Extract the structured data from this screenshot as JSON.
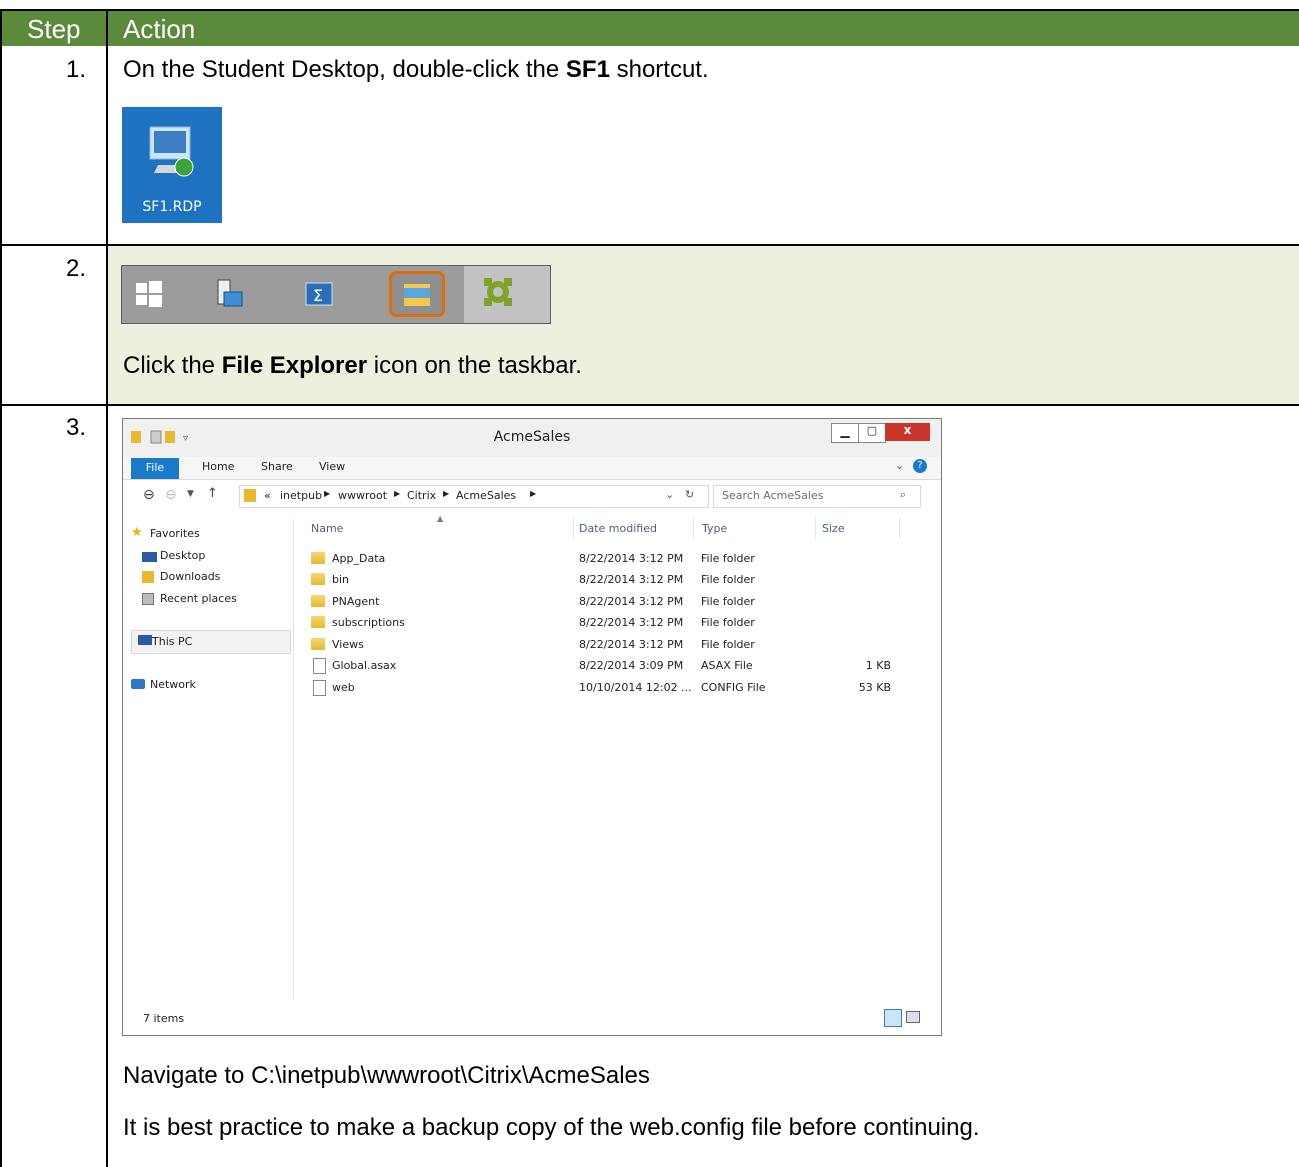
{
  "table": {
    "header_step": "Step",
    "header_action": "Action",
    "header_color": "#5a8a3a",
    "row_shade": "#ebf1de"
  },
  "steps": [
    {
      "number": "1.",
      "text_before": "On the Student Desktop, double-click the ",
      "bold": "SF1",
      "text_after": " shortcut.",
      "shortcut_label": "SF1.RDP"
    },
    {
      "number": "2.",
      "text_before": "Click the ",
      "bold": "File Explorer",
      "text_after": " icon on the taskbar.",
      "taskbar_icons": [
        "windows-start-icon",
        "server-manager-icon",
        "powershell-icon",
        "file-explorer-icon",
        "citrix-studio-icon"
      ],
      "highlight_color": "#e36c0a"
    },
    {
      "number": "3.",
      "line1": "Navigate to C:\\inetpub\\wwwroot\\Citrix\\AcmeSales",
      "line2": "It is best practice to make a backup copy of the web.config file before continuing."
    }
  ],
  "explorer": {
    "title": "AcmeSales",
    "ribbon_tabs": [
      "File",
      "Home",
      "Share",
      "View"
    ],
    "breadcrumb": [
      "«",
      "inetpub",
      "wwwroot",
      "Citrix",
      "AcmeSales"
    ],
    "search_placeholder": "Search AcmeSales",
    "nav": {
      "favorites": "Favorites",
      "desktop": "Desktop",
      "downloads": "Downloads",
      "recent": "Recent places",
      "thispc": "This PC",
      "network": "Network"
    },
    "columns": [
      "Name",
      "Date modified",
      "Type",
      "Size"
    ],
    "files": [
      {
        "name": "App_Data",
        "date": "8/22/2014 3:12 PM",
        "type": "File folder",
        "size": "",
        "kind": "folder"
      },
      {
        "name": "bin",
        "date": "8/22/2014 3:12 PM",
        "type": "File folder",
        "size": "",
        "kind": "folder"
      },
      {
        "name": "PNAgent",
        "date": "8/22/2014 3:12 PM",
        "type": "File folder",
        "size": "",
        "kind": "folder"
      },
      {
        "name": "subscriptions",
        "date": "8/22/2014 3:12 PM",
        "type": "File folder",
        "size": "",
        "kind": "folder"
      },
      {
        "name": "Views",
        "date": "8/22/2014 3:12 PM",
        "type": "File folder",
        "size": "",
        "kind": "folder"
      },
      {
        "name": "Global.asax",
        "date": "8/22/2014 3:09 PM",
        "type": "ASAX File",
        "size": "1 KB",
        "kind": "file"
      },
      {
        "name": "web",
        "date": "10/10/2014 12:02 ...",
        "type": "CONFIG File",
        "size": "53 KB",
        "kind": "file"
      }
    ],
    "status": "7 items"
  }
}
